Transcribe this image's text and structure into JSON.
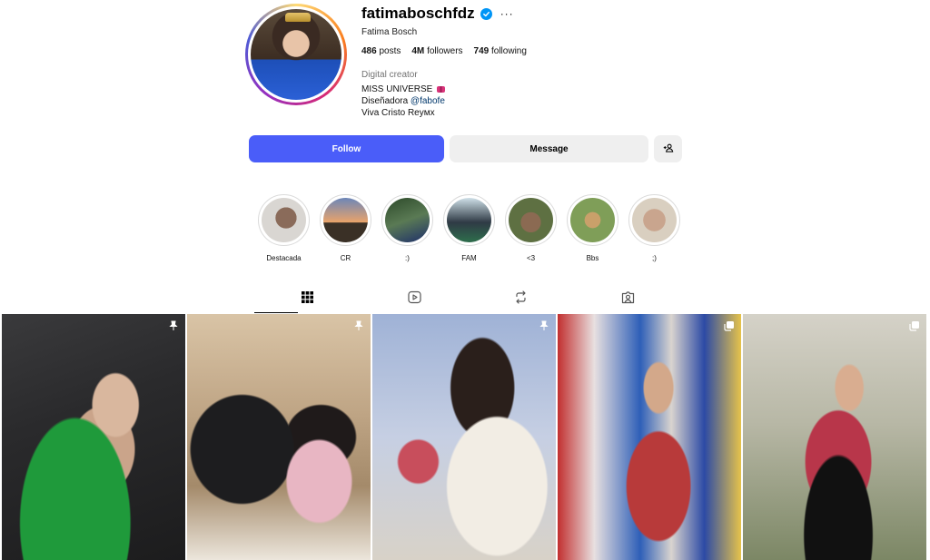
{
  "profile": {
    "username": "fatimaboschfdz",
    "verified": true,
    "full_name": "Fatima Bosch",
    "stats": {
      "posts_count": "486",
      "posts_label": "posts",
      "followers_count": "4M",
      "followers_label": "followers",
      "following_count": "749",
      "following_label": "following"
    },
    "category": "Digital creator",
    "bio": {
      "line1": "MISS UNIVERSE",
      "line2_prefix": "Diseñadora ",
      "line2_mention": "@fabofe",
      "line3": "Viva Cristo Reyмх"
    },
    "avatar_icon": "profile-photo"
  },
  "actions": {
    "follow_label": "Follow",
    "message_label": "Message",
    "add_user_icon": "person-add-icon"
  },
  "colors": {
    "follow_button": "#4a5df9",
    "secondary_button": "#efefef",
    "verified_badge": "#0095f6",
    "link": "#00376b",
    "muted_text": "#737373"
  },
  "highlights": [
    {
      "label": "Destacada",
      "gradient": "radial-gradient(circle at 55% 45%, #8a6b5a 0 30%, #d9d6d2 31%)"
    },
    {
      "label": "CR",
      "gradient": "linear-gradient(180deg, #6c86b8 0%, #e9a36a 55%, #3a3026 56%)"
    },
    {
      "label": ":)",
      "gradient": "linear-gradient(160deg, #2d4a2a 0%, #5a7a54 50%, #1e2f6a 100%)"
    },
    {
      "label": "FAM",
      "gradient": "linear-gradient(180deg, #cfe0e8 0%, #2f3a45 55%, #2e6e4c 100%)"
    },
    {
      "label": "<3",
      "gradient": "radial-gradient(circle at 50% 55%, #8b6a52 0 30%, #5e7042 31%)"
    },
    {
      "label": "Bbs",
      "gradient": "radial-gradient(circle at 50% 50%, #c9a06a 0 25%, #7f9e58 26%)"
    },
    {
      "label": ";)",
      "gradient": "radial-gradient(circle at 50% 50%, #c9a58e 0 35%, #d9cfc0 36%)"
    }
  ],
  "tabs": [
    {
      "name": "posts",
      "icon": "grid-icon",
      "active": true
    },
    {
      "name": "reels",
      "icon": "reels-icon",
      "active": false
    },
    {
      "name": "reposts",
      "icon": "repost-icon",
      "active": false
    },
    {
      "name": "tagged",
      "icon": "tagged-icon",
      "active": false
    }
  ],
  "posts": [
    {
      "badge": "pin-icon"
    },
    {
      "badge": "pin-icon"
    },
    {
      "badge": "pin-icon"
    },
    {
      "badge": "carousel-icon"
    },
    {
      "badge": "carousel-icon"
    }
  ]
}
